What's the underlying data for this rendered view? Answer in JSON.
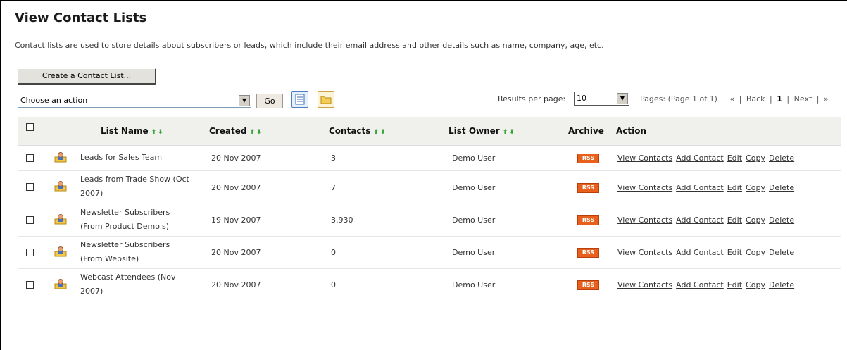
{
  "page": {
    "title": "View Contact Lists",
    "intro": "Contact lists are used to store details about subscribers or leads, which include their email address and other details such as name, company, age, etc."
  },
  "toolbar": {
    "create_label": "Create a Contact List...",
    "action_select_value": "Choose an action",
    "go_label": "Go",
    "list_view_icon": "list-view-icon",
    "folder_view_icon": "folder-view-icon"
  },
  "pagination": {
    "rpp_label": "Results per page:",
    "rpp_value": "10",
    "pages_text": "Pages: (Page 1 of 1)",
    "first": "«",
    "back": "Back",
    "current": "1",
    "next": "Next",
    "last": "»"
  },
  "table": {
    "headers": {
      "list_name": "List Name",
      "created": "Created",
      "contacts": "Contacts",
      "owner": "List Owner",
      "archive": "Archive",
      "action": "Action"
    },
    "rss_label": "RSS",
    "action_labels": {
      "view": "View Contacts",
      "add": "Add Contact",
      "edit": "Edit",
      "copy": "Copy",
      "delete": "Delete"
    },
    "rows": [
      {
        "name": "Leads for Sales Team",
        "created": "20 Nov 2007",
        "contacts": "3",
        "owner": "Demo User"
      },
      {
        "name": "Leads from Trade Show (Oct 2007)",
        "created": "20 Nov 2007",
        "contacts": "7",
        "owner": "Demo User"
      },
      {
        "name": "Newsletter Subscribers (From Product Demo's)",
        "created": "19 Nov 2007",
        "contacts": "3,930",
        "owner": "Demo User"
      },
      {
        "name": "Newsletter Subscribers (From Website)",
        "created": "20 Nov 2007",
        "contacts": "0",
        "owner": "Demo User"
      },
      {
        "name": "Webcast Attendees (Nov 2007)",
        "created": "20 Nov 2007",
        "contacts": "0",
        "owner": "Demo User"
      }
    ]
  },
  "colors": {
    "rss": "#e8601c",
    "sort_arrows": "#3aa33a",
    "header_bg": "#f0f0ec"
  }
}
